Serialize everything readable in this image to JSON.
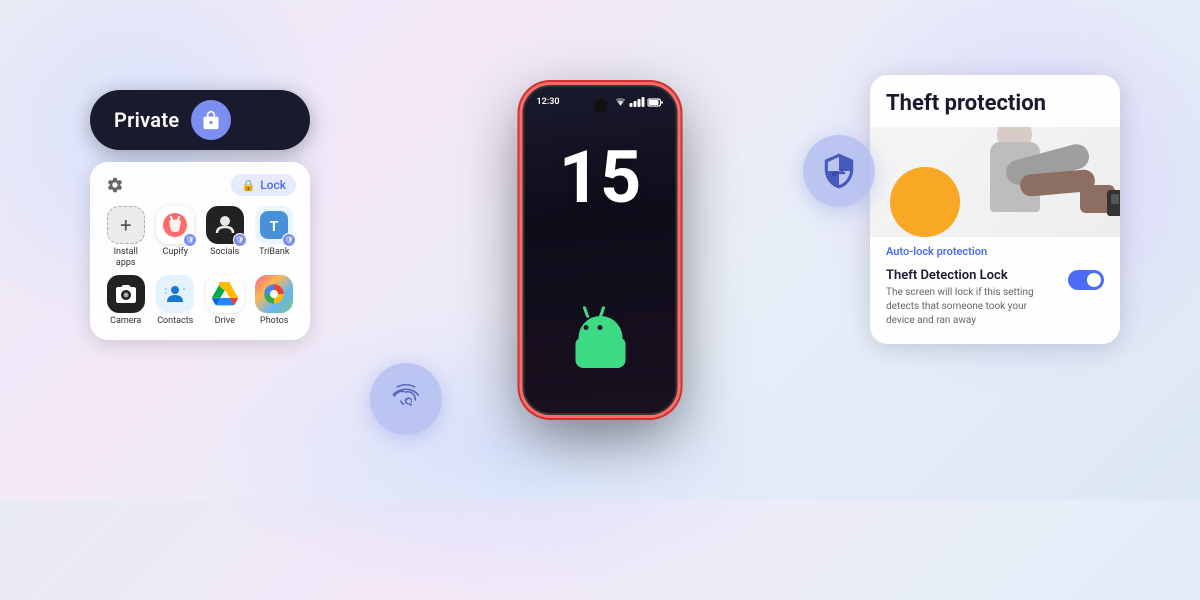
{
  "background": {
    "gradient": "linear-gradient(135deg, #e8eaf6, #f3e8f8, #e8eef8, #dde8f5)"
  },
  "phone": {
    "time": "12:30",
    "number": "15",
    "android_logo_color": "#3ddc84"
  },
  "left_panel": {
    "private_label": "Private",
    "lock_button_label": "Lock",
    "apps": [
      {
        "label": "Install apps",
        "type": "install"
      },
      {
        "label": "Cupify",
        "type": "cupify"
      },
      {
        "label": "Socials",
        "type": "socials"
      },
      {
        "label": "TriBank",
        "type": "tribank"
      },
      {
        "label": "Camera",
        "type": "camera"
      },
      {
        "label": "Contacts",
        "type": "contacts"
      },
      {
        "label": "Drive",
        "type": "drive"
      },
      {
        "label": "Photos",
        "type": "photos"
      }
    ]
  },
  "fingerprint_bubble": {
    "aria_label": "Fingerprint authentication"
  },
  "shield_bubble": {
    "aria_label": "Security shield"
  },
  "right_panel": {
    "title": "Theft protection",
    "auto_lock_label": "Auto-lock protection",
    "detection_title": "Theft Detection Lock",
    "detection_desc": "The screen will lock if this setting detects that someone took your device and ran away",
    "toggle_state": "on"
  }
}
